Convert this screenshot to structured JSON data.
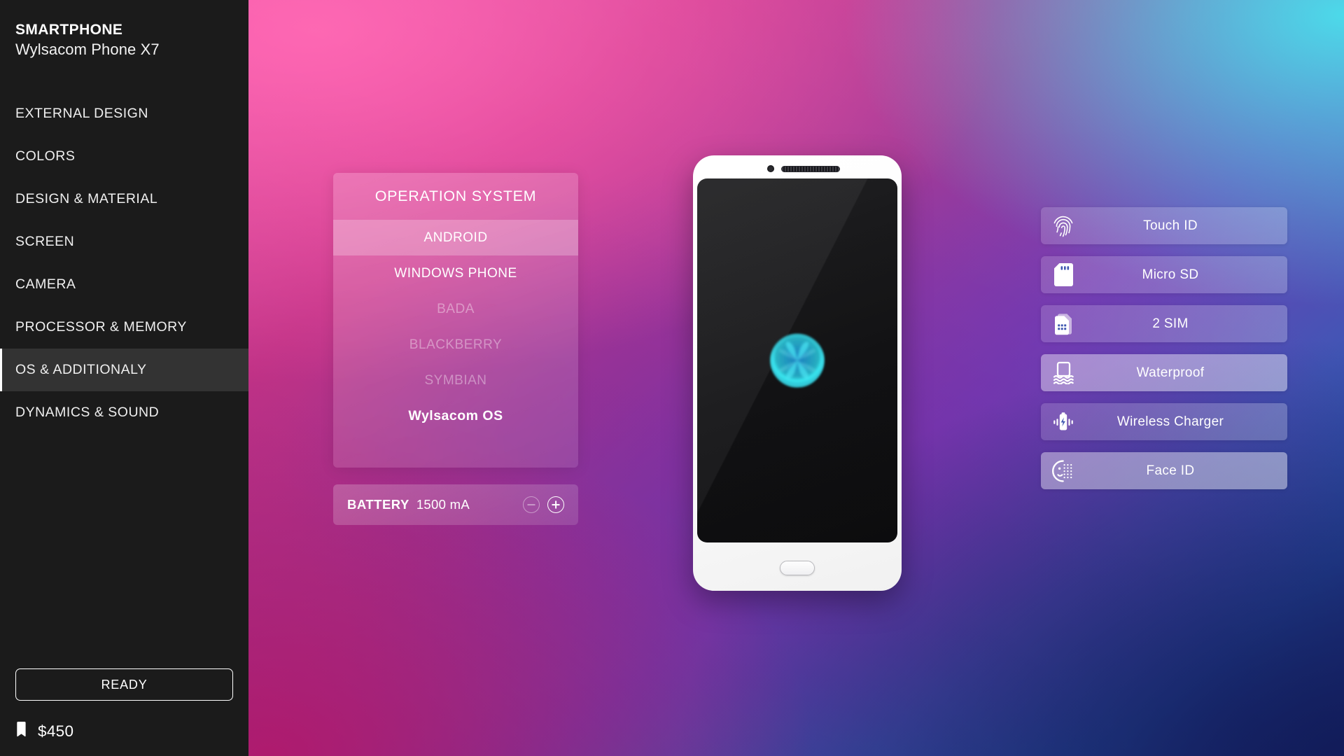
{
  "sidebar": {
    "brand_kicker": "SMARTPHONE",
    "brand_model": "Wylsacom Phone X7",
    "items": [
      {
        "label": "EXTERNAL DESIGN",
        "active": false
      },
      {
        "label": "COLORS",
        "active": false
      },
      {
        "label": "DESIGN & MATERIAL",
        "active": false
      },
      {
        "label": "SCREEN",
        "active": false
      },
      {
        "label": "CAMERA",
        "active": false
      },
      {
        "label": "PROCESSOR & MEMORY",
        "active": false
      },
      {
        "label": "OS & ADDITIONALY",
        "active": true
      },
      {
        "label": "DYNAMICS & SOUND",
        "active": false
      }
    ],
    "ready_label": "READY",
    "price": "$450",
    "price_icon": "price-tag-icon"
  },
  "os_panel": {
    "title": "OPERATION SYSTEM",
    "options": [
      {
        "label": "ANDROID",
        "state": "selected"
      },
      {
        "label": "WINDOWS PHONE",
        "state": "normal"
      },
      {
        "label": "BADA",
        "state": "disabled"
      },
      {
        "label": "BLACKBERRY",
        "state": "disabled"
      },
      {
        "label": "SYMBIAN",
        "state": "disabled"
      },
      {
        "label": "Wylsacom OS",
        "state": "custom"
      }
    ]
  },
  "battery": {
    "label": "BATTERY",
    "value": "1500 mA",
    "decrement_icon": "minus-circle-icon",
    "increment_icon": "plus-circle-icon",
    "decrement_enabled": false,
    "increment_enabled": true
  },
  "phone_preview": {
    "camera_icon": "front-camera-icon",
    "speaker_icon": "earpiece-speaker-icon",
    "screen_logo_icon": "wylsacom-logo-icon",
    "home_button_icon": "home-button-icon"
  },
  "features": [
    {
      "label": "Touch ID",
      "icon": "fingerprint-icon",
      "on": false
    },
    {
      "label": "Micro SD",
      "icon": "microsd-card-icon",
      "on": false
    },
    {
      "label": "2 SIM",
      "icon": "sim-card-icon",
      "on": false
    },
    {
      "label": "Waterproof",
      "icon": "waterproof-icon",
      "on": true
    },
    {
      "label": "Wireless Charger",
      "icon": "wireless-charger-icon",
      "on": false
    },
    {
      "label": "Face ID",
      "icon": "face-id-icon",
      "on": true
    }
  ],
  "colors": {
    "sidebar_bg": "#1b1b1b",
    "sidebar_active_bg": "#333333",
    "accent_bar": "#ffffff",
    "bg_pink": "#e84aa0",
    "bg_magenta": "#c41c78",
    "bg_purple": "#7e2daa",
    "bg_blue": "#3f54b4",
    "bg_cyan": "#40e0ec",
    "bg_navy": "#1d2f7e",
    "logo_cyan": "#2fd8ef",
    "text_primary": "#ffffff"
  }
}
